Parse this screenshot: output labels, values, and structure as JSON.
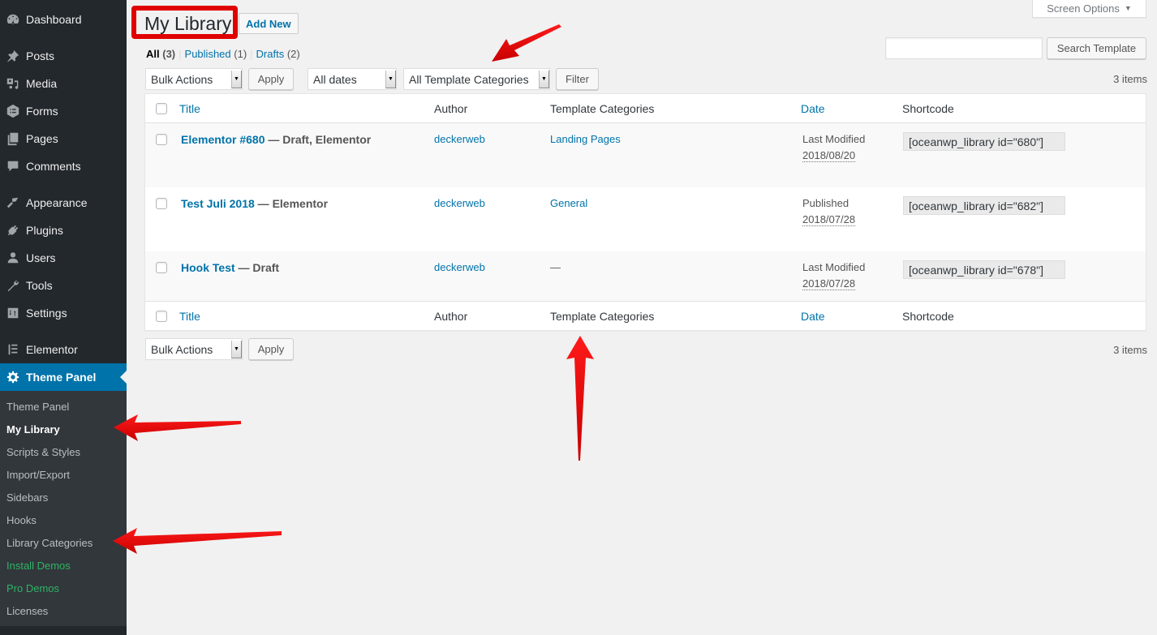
{
  "sidebar": {
    "menu": [
      {
        "label": "Dashboard",
        "icon": "dashboard-icon"
      },
      {
        "label": "Posts",
        "icon": "pin-icon"
      },
      {
        "label": "Media",
        "icon": "media-icon"
      },
      {
        "label": "Forms",
        "icon": "forms-icon"
      },
      {
        "label": "Pages",
        "icon": "pages-icon"
      },
      {
        "label": "Comments",
        "icon": "comment-icon"
      },
      {
        "label": "Appearance",
        "icon": "paintbrush-icon"
      },
      {
        "label": "Plugins",
        "icon": "plug-icon"
      },
      {
        "label": "Users",
        "icon": "user-icon"
      },
      {
        "label": "Tools",
        "icon": "wrench-icon"
      },
      {
        "label": "Settings",
        "icon": "settings-icon"
      },
      {
        "label": "Elementor",
        "icon": "elementor-icon"
      },
      {
        "label": "Theme Panel",
        "icon": "gear-icon",
        "current": true
      }
    ],
    "submenu": [
      {
        "label": "Theme Panel"
      },
      {
        "label": "My Library",
        "current": true
      },
      {
        "label": "Scripts & Styles"
      },
      {
        "label": "Import/Export"
      },
      {
        "label": "Sidebars"
      },
      {
        "label": "Hooks"
      },
      {
        "label": "Library Categories"
      },
      {
        "label": "Install Demos",
        "highlight": "#2fb364"
      },
      {
        "label": "Pro Demos",
        "highlight": "#2fb364"
      },
      {
        "label": "Licenses"
      }
    ]
  },
  "header": {
    "screen_options": "Screen Options",
    "page_title": "My Library",
    "add_new": "Add New"
  },
  "views": [
    {
      "label": "All",
      "count": "(3)",
      "active": true
    },
    {
      "label": "Published",
      "count": "(1)"
    },
    {
      "label": "Drafts",
      "count": "(2)"
    }
  ],
  "search": {
    "value": "",
    "button": "Search Template"
  },
  "tablenav_top": {
    "bulk_actions": "Bulk Actions",
    "apply": "Apply",
    "dates": "All dates",
    "categories": "All Template Categories",
    "filter": "Filter",
    "items": "3 items"
  },
  "tablenav_bottom": {
    "bulk_actions": "Bulk Actions",
    "apply": "Apply",
    "items": "3 items"
  },
  "table": {
    "columns": {
      "title": "Title",
      "author": "Author",
      "categories": "Template Categories",
      "date": "Date",
      "shortcode": "Shortcode"
    },
    "rows": [
      {
        "title": "Elementor #680",
        "state": " — Draft, Elementor",
        "author": "deckerweb",
        "category": "Landing Pages",
        "date_label": "Last Modified",
        "date": "2018/08/20",
        "shortcode": "[oceanwp_library id=\"680\"]"
      },
      {
        "title": "Test Juli 2018",
        "state": " — Elementor",
        "author": "deckerweb",
        "category": "General",
        "date_label": "Published",
        "date": "2018/07/28",
        "shortcode": "[oceanwp_library id=\"682\"]"
      },
      {
        "title": "Hook Test",
        "state": " — Draft",
        "author": "deckerweb",
        "category": "—",
        "date_label": "Last Modified",
        "date": "2018/07/28",
        "shortcode": "[oceanwp_library id=\"678\"]"
      }
    ]
  },
  "annotations": {
    "color": "#e00000"
  }
}
